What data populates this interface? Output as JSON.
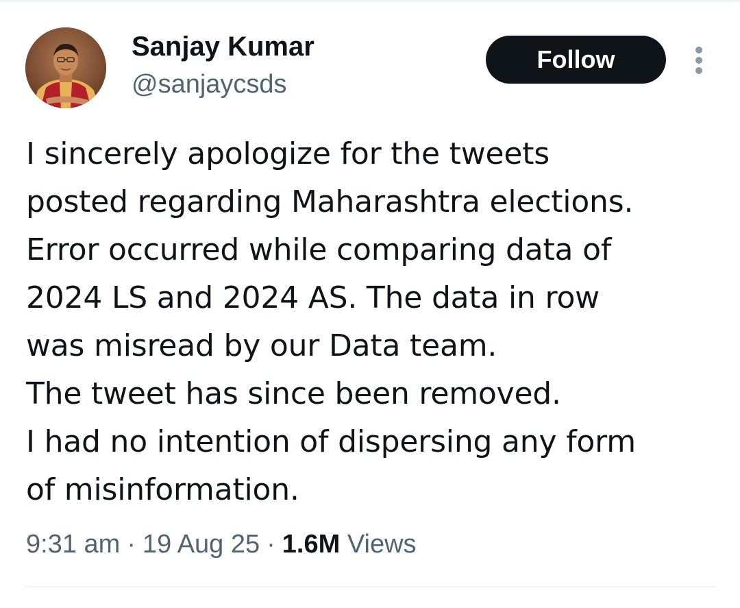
{
  "author": {
    "name": "Sanjay Kumar",
    "handle": "@sanjaycsds",
    "avatar_icon": "person-avatar"
  },
  "actions": {
    "follow_label": "Follow",
    "more_icon": "more-vertical-icon"
  },
  "tweet": {
    "lines": [
      "I sincerely apologize for the tweets",
      "posted regarding Maharashtra elections.",
      "Error occurred while comparing data of",
      "2024 LS and 2024 AS. The data in row",
      "was misread by our Data team.",
      "The tweet has since been removed.",
      "I had no intention of dispersing any form",
      "of misinformation."
    ]
  },
  "meta": {
    "time": "9:31 am",
    "separator": "·",
    "date": "19 Aug 25",
    "views_count": "1.6M",
    "views_label": "Views"
  },
  "colors": {
    "text_primary": "#0f1419",
    "text_secondary": "#536471",
    "button_bg": "#0f1419",
    "divider": "#eff3f4"
  }
}
